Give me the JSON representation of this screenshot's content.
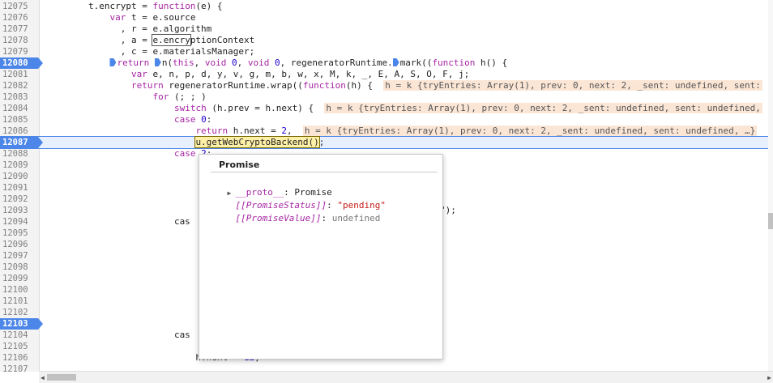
{
  "editor": {
    "lines": [
      {
        "num": "12075",
        "code": "t.encrypt = function(e) {",
        "indent": 8
      },
      {
        "num": "12076",
        "code": "var t = e.source",
        "indent": 12
      },
      {
        "num": "12077",
        "code": ", r = e.algorithm",
        "indent": 14
      },
      {
        "num": "12078",
        "code": ", a = e.encryptionContext",
        "indent": 14
      },
      {
        "num": "12079",
        "code": ", c = e.materialsManager;",
        "indent": 14
      },
      {
        "num": "12080",
        "code": "return n(this, void 0, void 0, regeneratorRuntime.mark((function h() {",
        "indent": 12
      },
      {
        "num": "12081",
        "code": "var e, n, p, d, y, v, g, m, b, w, x, M, k, _, E, A, S, O, F, j;",
        "indent": 16
      },
      {
        "num": "12082",
        "code": "return regeneratorRuntime.wrap((function(h) {",
        "indent": 16
      },
      {
        "num": "12083",
        "code": "for (; ; )",
        "indent": 20
      },
      {
        "num": "12084",
        "code": "switch (h.prev = h.next) {",
        "indent": 24
      },
      {
        "num": "12085",
        "code": "case 0:",
        "indent": 24
      },
      {
        "num": "12086",
        "code": "return h.next = 2,",
        "indent": 28
      },
      {
        "num": "12087",
        "code": "u.getWebCryptoBackend();",
        "indent": 28
      },
      {
        "num": "12088",
        "code": "case 2:",
        "indent": 24
      },
      {
        "num": "12089",
        "code": "",
        "indent": 0
      },
      {
        "num": "12090",
        "code": "",
        "indent": 0
      },
      {
        "num": "12091",
        "code": "",
        "indent": 0
      },
      {
        "num": "12092",
        "code": "",
        "indent": 0
      },
      {
        "num": "12093",
        "code": "\");",
        "indent": 0
      },
      {
        "num": "12094",
        "code": "cas",
        "indent": 24
      },
      {
        "num": "12095",
        "code": "",
        "indent": 0
      },
      {
        "num": "12096",
        "code": "",
        "indent": 0
      },
      {
        "num": "12097",
        "code": "",
        "indent": 0
      },
      {
        "num": "12098",
        "code": "",
        "indent": 0
      },
      {
        "num": "12099",
        "code": "",
        "indent": 0
      },
      {
        "num": "12100",
        "code": "",
        "indent": 0
      },
      {
        "num": "12101",
        "code": "",
        "indent": 0
      },
      {
        "num": "12102",
        "code": "",
        "indent": 0
      },
      {
        "num": "12103",
        "code": "",
        "indent": 0
      },
      {
        "num": "12104",
        "code": "cas",
        "indent": 24
      },
      {
        "num": "12105",
        "code": "",
        "indent": 0
      },
      {
        "num": "12106",
        "code": "h.next = 12;",
        "indent": 28
      },
      {
        "num": "12107",
        "code": "",
        "indent": 0
      }
    ],
    "breakpoints": [
      "12080",
      "12087",
      "12103"
    ],
    "current_line": "12087",
    "inline_values": {
      "line_12082": "h = k {tryEntries: Array(1), prev: 0, next: 2, _sent: undefined, sent:",
      "line_12084": "h = k {tryEntries: Array(1), prev: 0, next: 2, _sent: undefined, sent: undefined,",
      "line_12086": "h = k {tryEntries: Array(1), prev: 0, next: 2, _sent: undefined, sent: undefined, …}"
    }
  },
  "popup": {
    "title": "Promise",
    "proto_key": "__proto__",
    "proto_value": "Promise",
    "status_key": "[[PromiseStatus]]",
    "status_value": "\"pending\"",
    "value_key": "[[PromiseValue]]",
    "value_value": "undefined"
  },
  "colors": {
    "breakpoint": "#4c86e8",
    "current_line_bg": "#e8f0fe",
    "inline_value_bg": "#fbe6d6",
    "keyword": "#a626a4"
  }
}
